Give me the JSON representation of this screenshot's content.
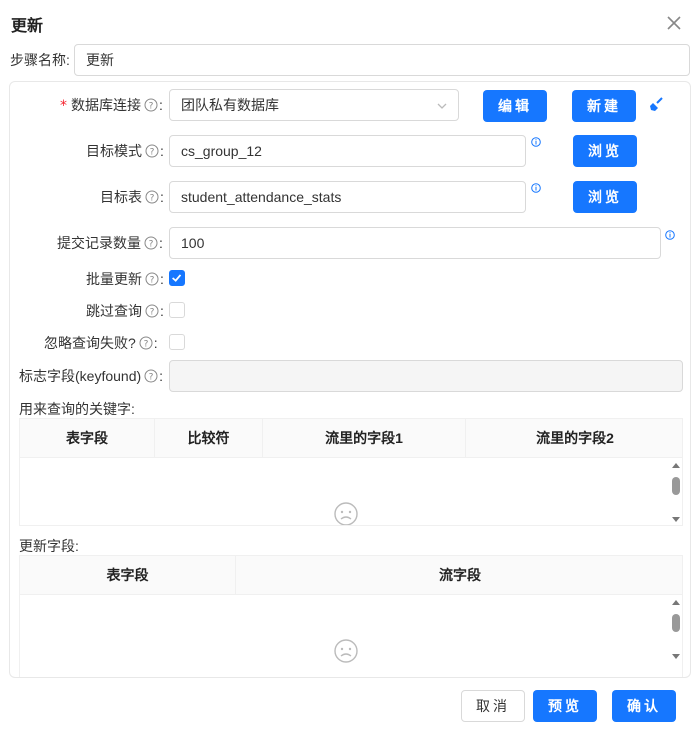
{
  "dialog": {
    "title": "更新",
    "step_name_label": "步骤名称:",
    "step_name_value": "更新"
  },
  "form": {
    "db_connection": {
      "label": "数据库连接",
      "value": "团队私有数据库",
      "edit_button": "编辑",
      "new_button": "新建"
    },
    "target_schema": {
      "label": "目标模式",
      "value": "cs_group_12",
      "browse_button": "浏览"
    },
    "target_table": {
      "label": "目标表",
      "value": "student_attendance_stats",
      "browse_button": "浏览"
    },
    "commit_size": {
      "label": "提交记录数量",
      "value": "100"
    },
    "batch_update": {
      "label": "批量更新",
      "checked": true
    },
    "skip_lookup": {
      "label": "跳过查询",
      "checked": false
    },
    "ignore_lookup_failure": {
      "label": "忽略查询失败?",
      "checked": false
    },
    "flag_field": {
      "label": "标志字段(keyfound)",
      "value": ""
    }
  },
  "lookup_keys": {
    "title": "用来查询的关键字:",
    "columns": [
      "表字段",
      "比较符",
      "流里的字段1",
      "流里的字段2"
    ]
  },
  "update_fields": {
    "title": "更新字段:",
    "columns": [
      "表字段",
      "流字段"
    ]
  },
  "footer": {
    "cancel": "取消",
    "preview": "预览",
    "confirm": "确认"
  },
  "colors": {
    "primary": "#1677ff",
    "required": "#f5222d",
    "border": "#d9d9d9"
  },
  "icons": {
    "close": "close-icon",
    "question": "question-circle-icon",
    "info": "info-circle-icon",
    "broom": "clear-broom-icon",
    "empty": "frown-icon",
    "chevron": "chevron-down-icon"
  }
}
